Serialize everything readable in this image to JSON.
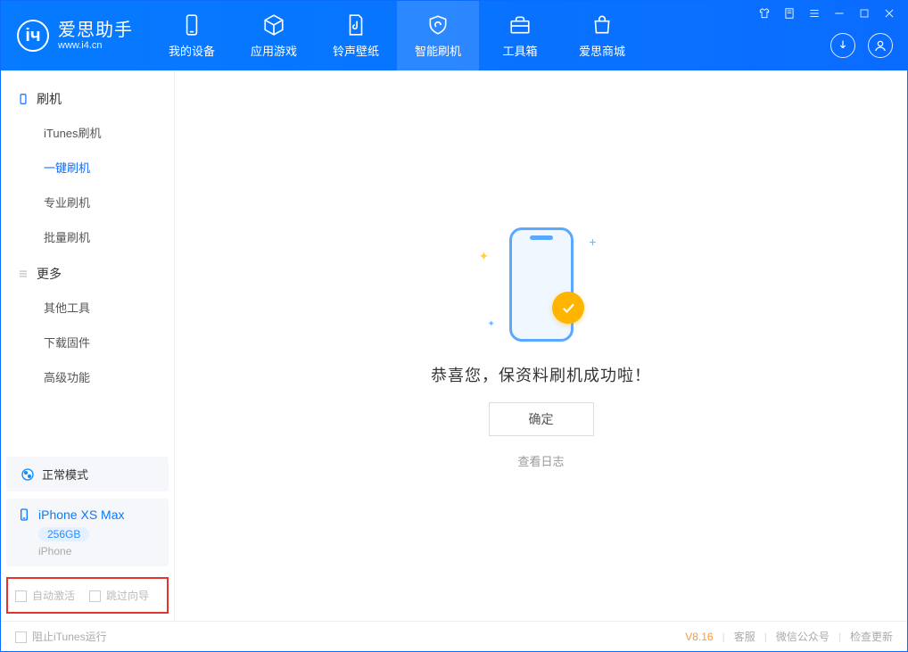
{
  "app": {
    "name": "爱思助手",
    "site": "www.i4.cn"
  },
  "tabs": {
    "device": "我的设备",
    "apps": "应用游戏",
    "ring": "铃声壁纸",
    "flash": "智能刷机",
    "tools": "工具箱",
    "store": "爱思商城"
  },
  "sidebar": {
    "flash_head": "刷机",
    "flash_items": {
      "itunes": "iTunes刷机",
      "oneclick": "一键刷机",
      "pro": "专业刷机",
      "batch": "批量刷机"
    },
    "more_head": "更多",
    "more_items": {
      "other": "其他工具",
      "firmware": "下载固件",
      "advanced": "高级功能"
    }
  },
  "mode": {
    "label": "正常模式"
  },
  "device": {
    "name": "iPhone XS Max",
    "capacity": "256GB",
    "type": "iPhone"
  },
  "options": {
    "auto_activate": "自动激活",
    "skip_guide": "跳过向导"
  },
  "main": {
    "success_msg": "恭喜您，保资料刷机成功啦！",
    "ok": "确定",
    "view_log": "查看日志"
  },
  "footer": {
    "block_itunes": "阻止iTunes运行",
    "version": "V8.16",
    "cs": "客服",
    "wechat": "微信公众号",
    "update": "检查更新"
  }
}
